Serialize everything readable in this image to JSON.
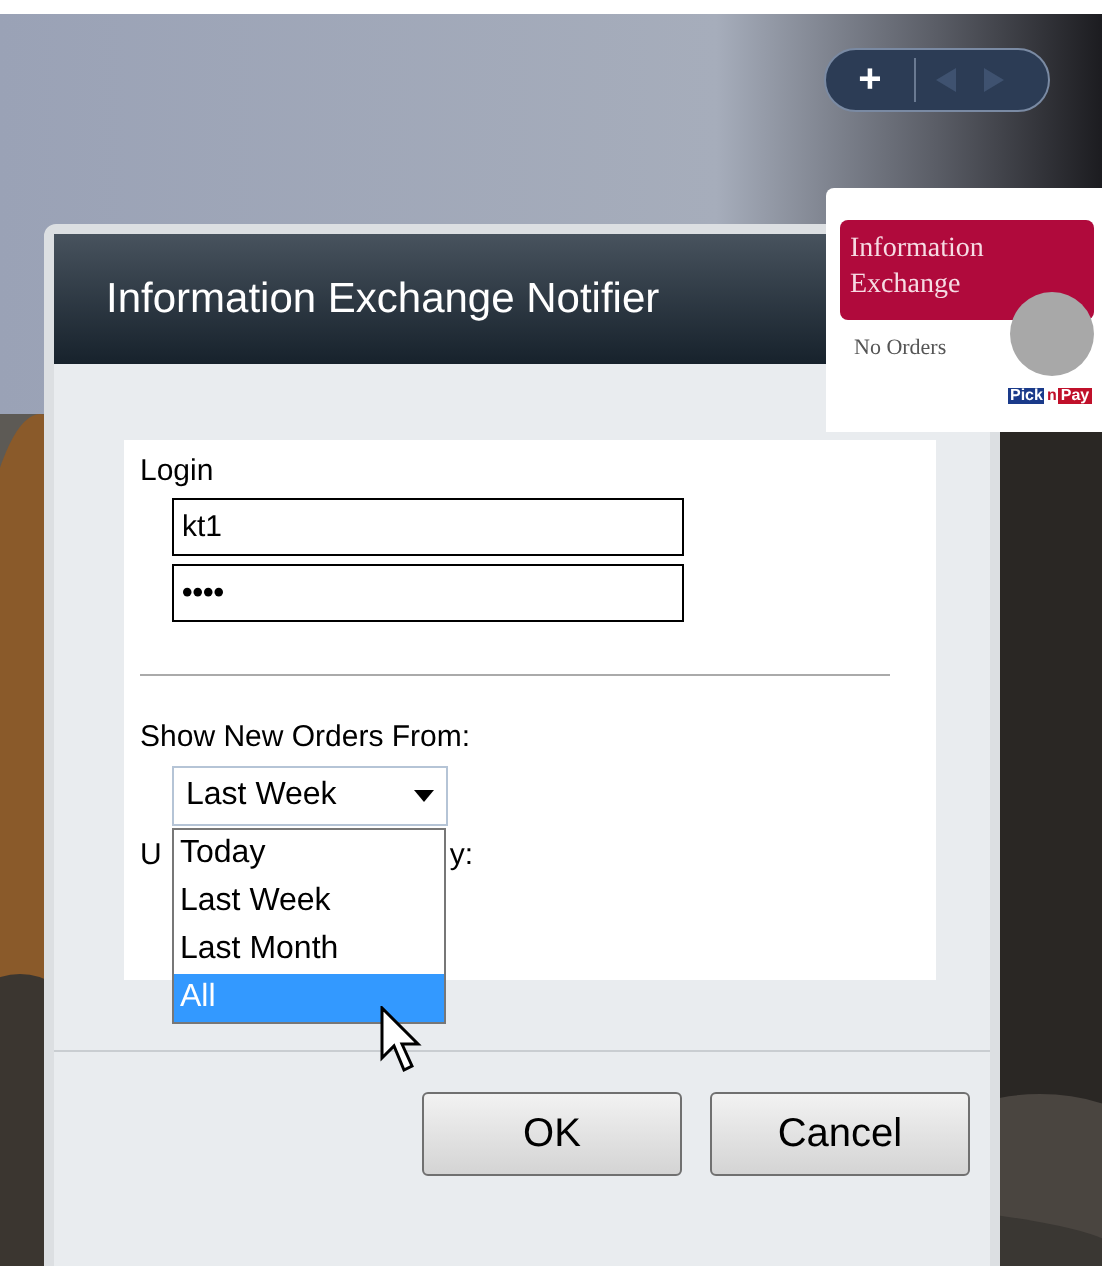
{
  "gadget_toolbar": {
    "add": "+"
  },
  "gadget": {
    "title": "Information Exchange",
    "status": "No Orders",
    "logo_left": "Pick",
    "logo_mid": "n",
    "logo_right": "Pay"
  },
  "dialog": {
    "title": "Information Exchange Notifier",
    "login_label": "Login",
    "username": "kt1",
    "password": "••••",
    "orders_label": "Show New Orders From:",
    "orders_value": "Last Week",
    "covered_label_start": "U",
    "covered_label_end": "y:",
    "dropdown_options": [
      {
        "label": "Today",
        "selected": false
      },
      {
        "label": "Last Week",
        "selected": false
      },
      {
        "label": "Last Month",
        "selected": false
      },
      {
        "label": "All",
        "selected": true
      }
    ],
    "buttons": [
      "OK",
      "Cancel"
    ]
  }
}
